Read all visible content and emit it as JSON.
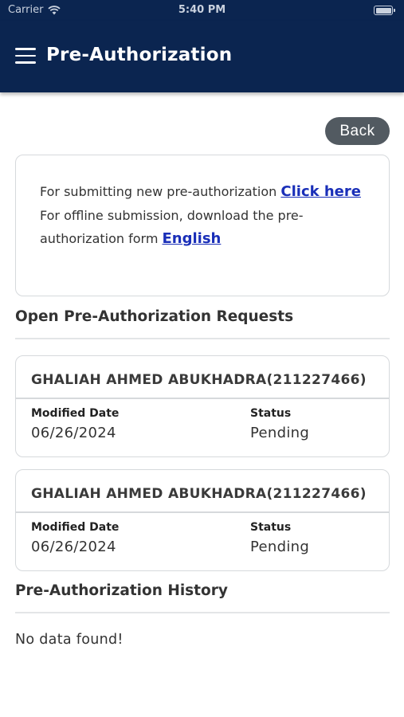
{
  "status_bar": {
    "carrier": "Carrier",
    "time": "5:40 PM",
    "icons": [
      "wifi-icon",
      "battery-icon"
    ]
  },
  "app_bar": {
    "menu_icon": "hamburger-menu-icon",
    "title": "Pre-Authorization",
    "background_color": "#0b2550"
  },
  "back_button": {
    "label": "Back"
  },
  "info": {
    "line1_text": "For submitting new pre-authorization ",
    "line1_link": "Click here",
    "line2_text": "For offline submission, download the pre-authorization form ",
    "line2_link": "English",
    "link_color": "#1a2fb8"
  },
  "open_requests": {
    "title": "Open Pre-Authorization Requests",
    "items": [
      {
        "name": "GHALIAH AHMED ABUKHADRA(211227466)",
        "modified_label": "Modified Date",
        "modified_value": "06/26/2024",
        "status_label": "Status",
        "status_value": "Pending"
      },
      {
        "name": "GHALIAH AHMED ABUKHADRA(211227466)",
        "modified_label": "Modified Date",
        "modified_value": "06/26/2024",
        "status_label": "Status",
        "status_value": "Pending"
      }
    ]
  },
  "history": {
    "title": "Pre-Authorization History",
    "empty_text": "No data found!"
  }
}
